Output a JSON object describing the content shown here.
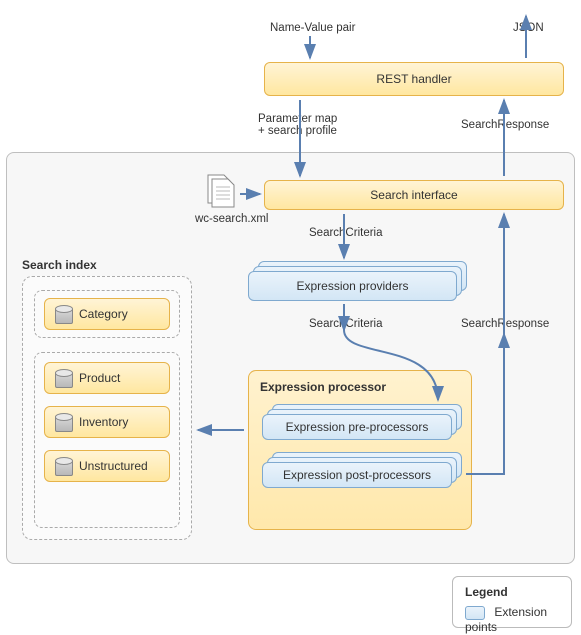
{
  "labels": {
    "input_top": "Name-Value pair",
    "output_top": "JSON",
    "rest_handler": "REST handler",
    "param_map": "Parameter map\n+ search profile",
    "search_response_upper": "SearchResponse",
    "search_interface": "Search interface",
    "wc_search_xml": "wc-search.xml",
    "search_criteria_1": "SearchCriteria",
    "expression_providers": "Expression providers",
    "search_criteria_2": "SearchCriteria",
    "search_response_lower": "SearchResponse",
    "expression_processor_title": "Expression processor",
    "expression_pre": "Expression pre-processors",
    "expression_post": "Expression post-processors",
    "search_index_title": "Search index",
    "index_items": [
      "Category",
      "Product",
      "Inventory",
      "Unstructured"
    ],
    "legend_title": "Legend",
    "legend_extension": "Extension points"
  },
  "colors": {
    "arrow": "#5a7fb0",
    "yellow_border": "#e6b34a",
    "blue_border": "#7fa9cf"
  }
}
